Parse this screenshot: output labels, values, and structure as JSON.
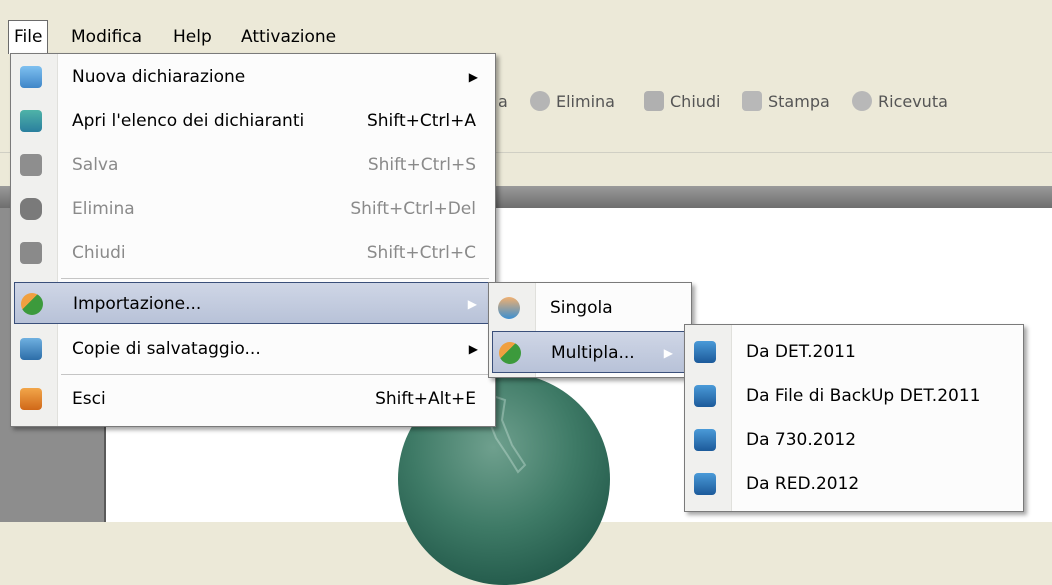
{
  "menubar": {
    "items": [
      "File",
      "Modifica",
      "Help",
      "Attivazione"
    ]
  },
  "toolbar": {
    "buttons": [
      "Elimina",
      "Chiudi",
      "Stampa",
      "Ricevuta"
    ],
    "partial_text": "a"
  },
  "file_menu": {
    "items": [
      {
        "label": "Nuova dichiarazione",
        "shortcut": "",
        "icon": "new-doc-icon"
      },
      {
        "label": "Apri l'elenco dei dichiaranti",
        "shortcut": "Shift+Ctrl+A",
        "icon": "open-list-icon"
      },
      {
        "label": "Salva",
        "shortcut": "Shift+Ctrl+S",
        "icon": "save-icon"
      },
      {
        "label": "Elimina",
        "shortcut": "Shift+Ctrl+Del",
        "icon": "delete-icon"
      },
      {
        "label": "Chiudi",
        "shortcut": "Shift+Ctrl+C",
        "icon": "close-icon"
      },
      {
        "label": "Importazione...",
        "shortcut": "",
        "icon": "import-icon"
      },
      {
        "label": "Copie di salvataggio...",
        "shortcut": "",
        "icon": "backup-icon"
      },
      {
        "label": "Esci",
        "shortcut": "Shift+Alt+E",
        "icon": "exit-icon"
      }
    ]
  },
  "import_menu": {
    "items": [
      {
        "label": "Singola",
        "icon": "single-user-icon"
      },
      {
        "label": "Multipla...",
        "icon": "multi-user-icon"
      }
    ]
  },
  "multipla_menu": {
    "items": [
      {
        "label": "Da DET.2011",
        "icon": "database-icon"
      },
      {
        "label": "Da File di BackUp DET.2011",
        "icon": "database-icon"
      },
      {
        "label": "Da 730.2012",
        "icon": "database-icon"
      },
      {
        "label": "Da RED.2012",
        "icon": "database-icon"
      }
    ]
  },
  "colors": {
    "menu_highlight": "#b8c2d8",
    "background": "#ece9d8",
    "disabled_text": "#8a8a8a"
  }
}
